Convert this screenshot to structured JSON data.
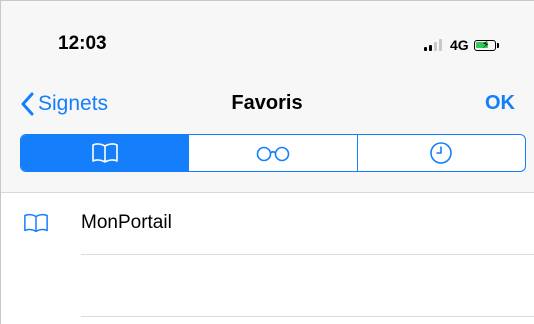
{
  "status_bar": {
    "time": "12:03",
    "network": "4G",
    "battery_icon": "battery-charging-icon",
    "signal_icon": "cellular-signal-icon"
  },
  "nav": {
    "back_label": "Signets",
    "title": "Favoris",
    "done_label": "OK"
  },
  "segments": [
    {
      "icon": "book-icon",
      "selected": true
    },
    {
      "icon": "reading-glasses-icon",
      "selected": false
    },
    {
      "icon": "clock-icon",
      "selected": false
    }
  ],
  "list": {
    "items": [
      {
        "label": "MonPortail",
        "icon": "book-icon"
      },
      {
        "label": "",
        "icon": ""
      }
    ]
  },
  "colors": {
    "accent": "#147efb",
    "battery": "#34c759",
    "header_bg": "#f7f7f7"
  }
}
